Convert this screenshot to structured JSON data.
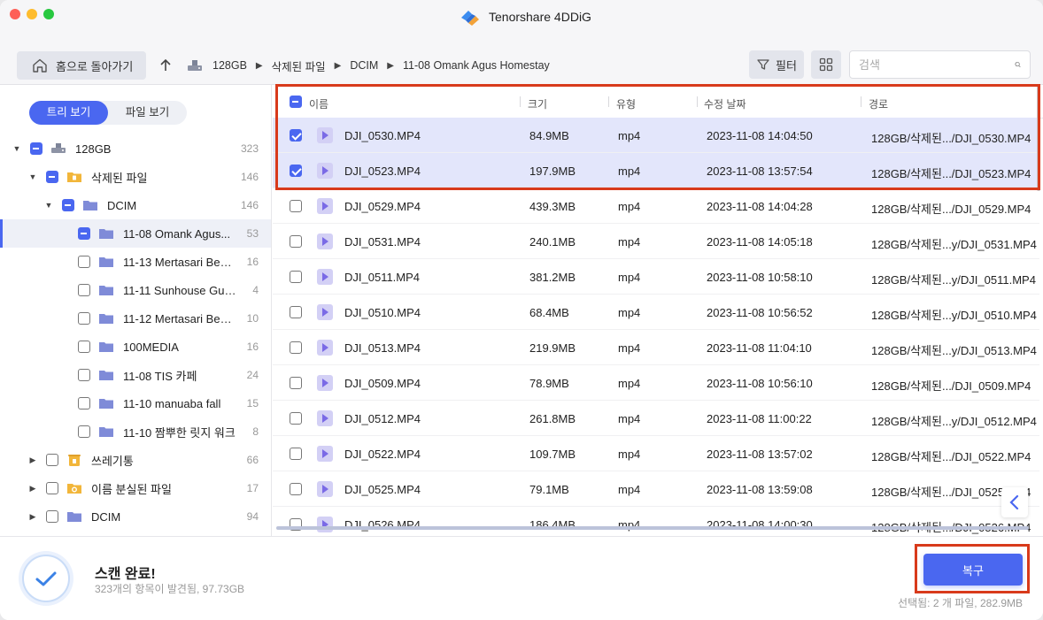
{
  "app": {
    "title": "Tenorshare 4DDiG"
  },
  "toolbar": {
    "home_label": "홈으로 돌아가기",
    "breadcrumb": [
      "128GB",
      "삭제된 파일",
      "DCIM",
      "11-08 Omank Agus Homestay"
    ],
    "filter_label": "필터",
    "search_placeholder": "검색"
  },
  "sidebar": {
    "tree_view_label": "트리 보기",
    "file_view_label": "파일 보기",
    "items": [
      {
        "label": "128GB",
        "count": "323",
        "icon": "drive-icon",
        "check": "partial",
        "caret": "down"
      },
      {
        "label": "삭제된 파일",
        "count": "146",
        "icon": "trash-folder-icon",
        "check": "partial",
        "caret": "down"
      },
      {
        "label": "DCIM",
        "count": "146",
        "icon": "folder-icon",
        "check": "partial",
        "caret": "down"
      },
      {
        "label": "11-08 Omank Agus...",
        "count": "53",
        "icon": "folder-icon",
        "check": "partial",
        "caret": ""
      },
      {
        "label": "11-13 Mertasari Beach",
        "count": "16",
        "icon": "folder-icon",
        "check": "off",
        "caret": ""
      },
      {
        "label": "11-11 Sunhouse Guest...",
        "count": "4",
        "icon": "folder-icon",
        "check": "off",
        "caret": ""
      },
      {
        "label": "11-12 Mertasari Beach",
        "count": "10",
        "icon": "folder-icon",
        "check": "off",
        "caret": ""
      },
      {
        "label": "100MEDIA",
        "count": "16",
        "icon": "folder-icon",
        "check": "off",
        "caret": ""
      },
      {
        "label": "11-08 TIS 카페",
        "count": "24",
        "icon": "folder-icon",
        "check": "off",
        "caret": ""
      },
      {
        "label": "11-10 manuaba fall",
        "count": "15",
        "icon": "folder-icon",
        "check": "off",
        "caret": ""
      },
      {
        "label": "11-10 짬뿌한 릿지 워크",
        "count": "8",
        "icon": "folder-icon",
        "check": "off",
        "caret": ""
      },
      {
        "label": "쓰레기통",
        "count": "66",
        "icon": "trash-bin-icon",
        "check": "off",
        "caret": "right"
      },
      {
        "label": "이름 분실된 파일",
        "count": "17",
        "icon": "lost-folder-icon",
        "check": "off",
        "caret": "right"
      },
      {
        "label": "DCIM",
        "count": "94",
        "icon": "folder-icon",
        "check": "off",
        "caret": "right"
      }
    ]
  },
  "list": {
    "columns": [
      "이름",
      "크기",
      "유형",
      "수정 날짜",
      "경로"
    ],
    "rows": [
      {
        "name": "DJI_0530.MP4",
        "size": "84.9MB",
        "type": "mp4",
        "date": "2023-11-08 14:04:50",
        "path": "128GB/삭제된.../DJI_0530.MP4",
        "checked": true
      },
      {
        "name": "DJI_0523.MP4",
        "size": "197.9MB",
        "type": "mp4",
        "date": "2023-11-08 13:57:54",
        "path": "128GB/삭제된.../DJI_0523.MP4",
        "checked": true
      },
      {
        "name": "DJI_0529.MP4",
        "size": "439.3MB",
        "type": "mp4",
        "date": "2023-11-08 14:04:28",
        "path": "128GB/삭제된.../DJI_0529.MP4",
        "checked": false
      },
      {
        "name": "DJI_0531.MP4",
        "size": "240.1MB",
        "type": "mp4",
        "date": "2023-11-08 14:05:18",
        "path": "128GB/삭제된...y/DJI_0531.MP4",
        "checked": false
      },
      {
        "name": "DJI_0511.MP4",
        "size": "381.2MB",
        "type": "mp4",
        "date": "2023-11-08 10:58:10",
        "path": "128GB/삭제된...y/DJI_0511.MP4",
        "checked": false
      },
      {
        "name": "DJI_0510.MP4",
        "size": "68.4MB",
        "type": "mp4",
        "date": "2023-11-08 10:56:52",
        "path": "128GB/삭제된...y/DJI_0510.MP4",
        "checked": false
      },
      {
        "name": "DJI_0513.MP4",
        "size": "219.9MB",
        "type": "mp4",
        "date": "2023-11-08 11:04:10",
        "path": "128GB/삭제된...y/DJI_0513.MP4",
        "checked": false
      },
      {
        "name": "DJI_0509.MP4",
        "size": "78.9MB",
        "type": "mp4",
        "date": "2023-11-08 10:56:10",
        "path": "128GB/삭제된.../DJI_0509.MP4",
        "checked": false
      },
      {
        "name": "DJI_0512.MP4",
        "size": "261.8MB",
        "type": "mp4",
        "date": "2023-11-08 11:00:22",
        "path": "128GB/삭제된...y/DJI_0512.MP4",
        "checked": false
      },
      {
        "name": "DJI_0522.MP4",
        "size": "109.7MB",
        "type": "mp4",
        "date": "2023-11-08 13:57:02",
        "path": "128GB/삭제된.../DJI_0522.MP4",
        "checked": false
      },
      {
        "name": "DJI_0525.MP4",
        "size": "79.1MB",
        "type": "mp4",
        "date": "2023-11-08 13:59:08",
        "path": "128GB/삭제된.../DJI_0525.MP4",
        "checked": false
      },
      {
        "name": "DJI_0526.MP4",
        "size": "186.4MB",
        "type": "mp4",
        "date": "2023-11-08 14:00:30",
        "path": "128GB/삭제된.../DJI_0526.MP4",
        "checked": false
      }
    ]
  },
  "footer": {
    "status_title": "스캔 완료!",
    "status_sub": "323개의 항목이 발견됨, 97.73GB",
    "recover_label": "복구",
    "selection_info": "선택됨: 2 개 파일, 282.9MB"
  },
  "colors": {
    "accent": "#4a67f0",
    "highlight": "#d83a1b",
    "selected_row": "#e3e6fb"
  }
}
